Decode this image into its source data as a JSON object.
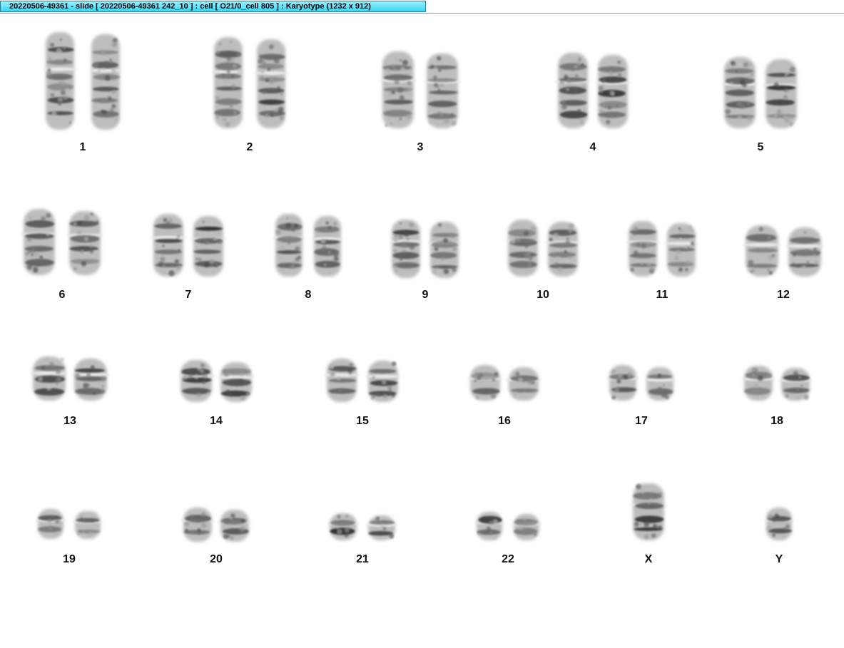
{
  "window": {
    "title": "20220506-49361 - slide [ 20220506-49361 242_10 ] : cell [ O21/0_cell 805 ] : Karyotype  (1232 x 912)"
  },
  "chromosomes": [
    {
      "label": "1",
      "count": 2
    },
    {
      "label": "2",
      "count": 2
    },
    {
      "label": "3",
      "count": 2
    },
    {
      "label": "4",
      "count": 2
    },
    {
      "label": "5",
      "count": 2
    },
    {
      "label": "6",
      "count": 2
    },
    {
      "label": "7",
      "count": 2
    },
    {
      "label": "8",
      "count": 2
    },
    {
      "label": "9",
      "count": 2
    },
    {
      "label": "10",
      "count": 2
    },
    {
      "label": "11",
      "count": 2
    },
    {
      "label": "12",
      "count": 2
    },
    {
      "label": "13",
      "count": 2
    },
    {
      "label": "14",
      "count": 2
    },
    {
      "label": "15",
      "count": 2
    },
    {
      "label": "16",
      "count": 2
    },
    {
      "label": "17",
      "count": 2
    },
    {
      "label": "18",
      "count": 2
    },
    {
      "label": "19",
      "count": 2
    },
    {
      "label": "20",
      "count": 2
    },
    {
      "label": "21",
      "count": 2
    },
    {
      "label": "22",
      "count": 2
    },
    {
      "label": "X",
      "count": 1
    },
    {
      "label": "Y",
      "count": 1
    }
  ],
  "colors": {
    "tab": "#38d6f5",
    "chromatin": "#2a2a2a",
    "background": "#ffffff"
  }
}
